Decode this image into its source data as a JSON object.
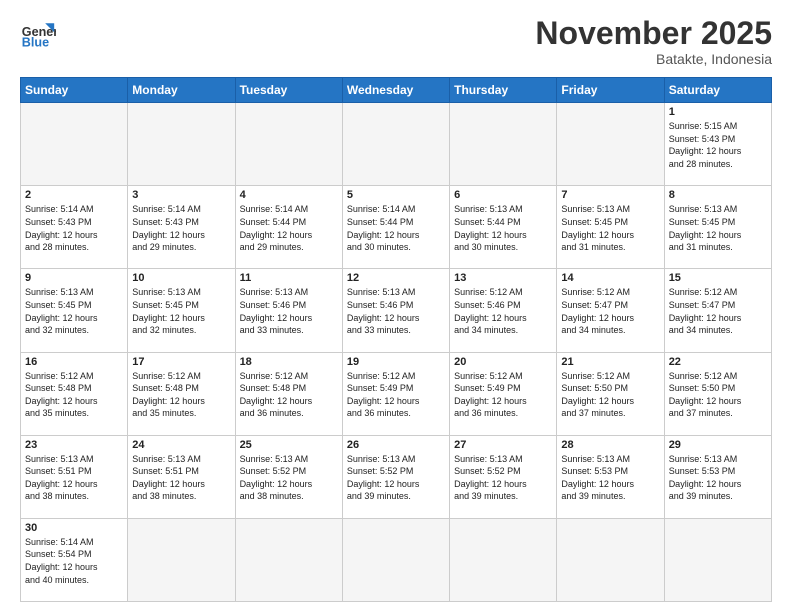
{
  "logo": {
    "line1": "General",
    "line2": "Blue"
  },
  "title": "November 2025",
  "location": "Batakte, Indonesia",
  "days_header": [
    "Sunday",
    "Monday",
    "Tuesday",
    "Wednesday",
    "Thursday",
    "Friday",
    "Saturday"
  ],
  "weeks": [
    [
      {
        "day": "",
        "info": ""
      },
      {
        "day": "",
        "info": ""
      },
      {
        "day": "",
        "info": ""
      },
      {
        "day": "",
        "info": ""
      },
      {
        "day": "",
        "info": ""
      },
      {
        "day": "",
        "info": ""
      },
      {
        "day": "1",
        "info": "Sunrise: 5:15 AM\nSunset: 5:43 PM\nDaylight: 12 hours\nand 28 minutes."
      }
    ],
    [
      {
        "day": "2",
        "info": "Sunrise: 5:14 AM\nSunset: 5:43 PM\nDaylight: 12 hours\nand 28 minutes."
      },
      {
        "day": "3",
        "info": "Sunrise: 5:14 AM\nSunset: 5:43 PM\nDaylight: 12 hours\nand 29 minutes."
      },
      {
        "day": "4",
        "info": "Sunrise: 5:14 AM\nSunset: 5:44 PM\nDaylight: 12 hours\nand 29 minutes."
      },
      {
        "day": "5",
        "info": "Sunrise: 5:14 AM\nSunset: 5:44 PM\nDaylight: 12 hours\nand 30 minutes."
      },
      {
        "day": "6",
        "info": "Sunrise: 5:13 AM\nSunset: 5:44 PM\nDaylight: 12 hours\nand 30 minutes."
      },
      {
        "day": "7",
        "info": "Sunrise: 5:13 AM\nSunset: 5:45 PM\nDaylight: 12 hours\nand 31 minutes."
      },
      {
        "day": "8",
        "info": "Sunrise: 5:13 AM\nSunset: 5:45 PM\nDaylight: 12 hours\nand 31 minutes."
      }
    ],
    [
      {
        "day": "9",
        "info": "Sunrise: 5:13 AM\nSunset: 5:45 PM\nDaylight: 12 hours\nand 32 minutes."
      },
      {
        "day": "10",
        "info": "Sunrise: 5:13 AM\nSunset: 5:45 PM\nDaylight: 12 hours\nand 32 minutes."
      },
      {
        "day": "11",
        "info": "Sunrise: 5:13 AM\nSunset: 5:46 PM\nDaylight: 12 hours\nand 33 minutes."
      },
      {
        "day": "12",
        "info": "Sunrise: 5:13 AM\nSunset: 5:46 PM\nDaylight: 12 hours\nand 33 minutes."
      },
      {
        "day": "13",
        "info": "Sunrise: 5:12 AM\nSunset: 5:46 PM\nDaylight: 12 hours\nand 34 minutes."
      },
      {
        "day": "14",
        "info": "Sunrise: 5:12 AM\nSunset: 5:47 PM\nDaylight: 12 hours\nand 34 minutes."
      },
      {
        "day": "15",
        "info": "Sunrise: 5:12 AM\nSunset: 5:47 PM\nDaylight: 12 hours\nand 34 minutes."
      }
    ],
    [
      {
        "day": "16",
        "info": "Sunrise: 5:12 AM\nSunset: 5:48 PM\nDaylight: 12 hours\nand 35 minutes."
      },
      {
        "day": "17",
        "info": "Sunrise: 5:12 AM\nSunset: 5:48 PM\nDaylight: 12 hours\nand 35 minutes."
      },
      {
        "day": "18",
        "info": "Sunrise: 5:12 AM\nSunset: 5:48 PM\nDaylight: 12 hours\nand 36 minutes."
      },
      {
        "day": "19",
        "info": "Sunrise: 5:12 AM\nSunset: 5:49 PM\nDaylight: 12 hours\nand 36 minutes."
      },
      {
        "day": "20",
        "info": "Sunrise: 5:12 AM\nSunset: 5:49 PM\nDaylight: 12 hours\nand 36 minutes."
      },
      {
        "day": "21",
        "info": "Sunrise: 5:12 AM\nSunset: 5:50 PM\nDaylight: 12 hours\nand 37 minutes."
      },
      {
        "day": "22",
        "info": "Sunrise: 5:12 AM\nSunset: 5:50 PM\nDaylight: 12 hours\nand 37 minutes."
      }
    ],
    [
      {
        "day": "23",
        "info": "Sunrise: 5:13 AM\nSunset: 5:51 PM\nDaylight: 12 hours\nand 38 minutes."
      },
      {
        "day": "24",
        "info": "Sunrise: 5:13 AM\nSunset: 5:51 PM\nDaylight: 12 hours\nand 38 minutes."
      },
      {
        "day": "25",
        "info": "Sunrise: 5:13 AM\nSunset: 5:52 PM\nDaylight: 12 hours\nand 38 minutes."
      },
      {
        "day": "26",
        "info": "Sunrise: 5:13 AM\nSunset: 5:52 PM\nDaylight: 12 hours\nand 39 minutes."
      },
      {
        "day": "27",
        "info": "Sunrise: 5:13 AM\nSunset: 5:52 PM\nDaylight: 12 hours\nand 39 minutes."
      },
      {
        "day": "28",
        "info": "Sunrise: 5:13 AM\nSunset: 5:53 PM\nDaylight: 12 hours\nand 39 minutes."
      },
      {
        "day": "29",
        "info": "Sunrise: 5:13 AM\nSunset: 5:53 PM\nDaylight: 12 hours\nand 39 minutes."
      }
    ],
    [
      {
        "day": "30",
        "info": "Sunrise: 5:14 AM\nSunset: 5:54 PM\nDaylight: 12 hours\nand 40 minutes."
      },
      {
        "day": "",
        "info": ""
      },
      {
        "day": "",
        "info": ""
      },
      {
        "day": "",
        "info": ""
      },
      {
        "day": "",
        "info": ""
      },
      {
        "day": "",
        "info": ""
      },
      {
        "day": "",
        "info": ""
      }
    ]
  ]
}
